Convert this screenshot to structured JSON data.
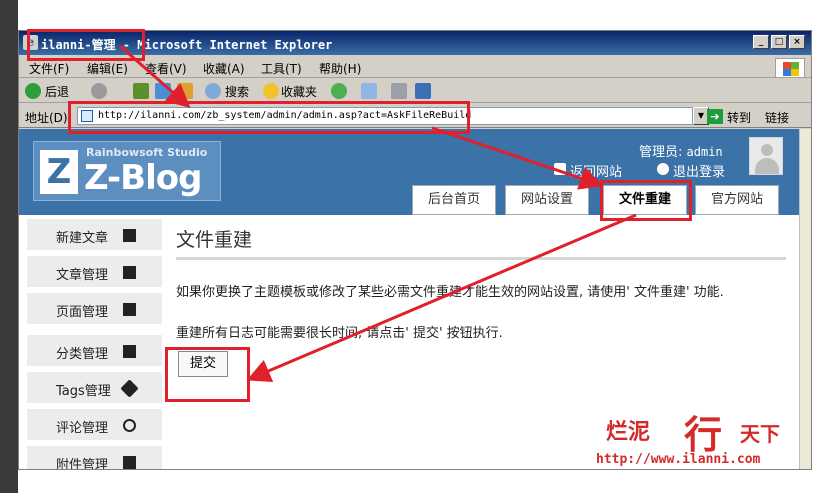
{
  "browser": {
    "window_title": "ilanni-管理 - Microsoft Internet Explorer",
    "menu": [
      "文件(F)",
      "编辑(E)",
      "查看(V)",
      "收藏(A)",
      "工具(T)",
      "帮助(H)"
    ],
    "toolbar": {
      "back": "后退",
      "search": "搜索",
      "favorites": "收藏夹"
    },
    "address_label": "地址(D)",
    "address_url": "http://ilanni.com/zb_system/admin/admin.asp?act=AskFileReBuild",
    "go_label": "转到",
    "links_label": "链接"
  },
  "header": {
    "logo_sub": "Rainbowsoft Studio",
    "logo_main": "Z-Blog",
    "admin_label": "管理员:",
    "admin_name": "admin",
    "back_site": "返回网站",
    "logout": "退出登录",
    "tabs": [
      "后台首页",
      "网站设置",
      "文件重建",
      "官方网站"
    ],
    "active_tab": "文件重建"
  },
  "sidebar": {
    "items": [
      "新建文章",
      "文章管理",
      "页面管理",
      "分类管理",
      "Tags管理",
      "评论管理",
      "附件管理"
    ]
  },
  "main": {
    "title": "文件重建",
    "para1": "如果你更换了主题模板或修改了某些必需文件重建才能生效的网站设置, 请使用' 文件重建' 功能.",
    "para2": "重建所有日志可能需要很长时间, 请点击' 提交' 按钮执行.",
    "submit_label": "提交"
  },
  "watermark": {
    "text_left": "烂泥",
    "text_big": "行",
    "text_right": "天下",
    "url": "http://www.ilanni.com"
  },
  "annotation_color": "#e0202a",
  "header_color": "#3b72a8"
}
